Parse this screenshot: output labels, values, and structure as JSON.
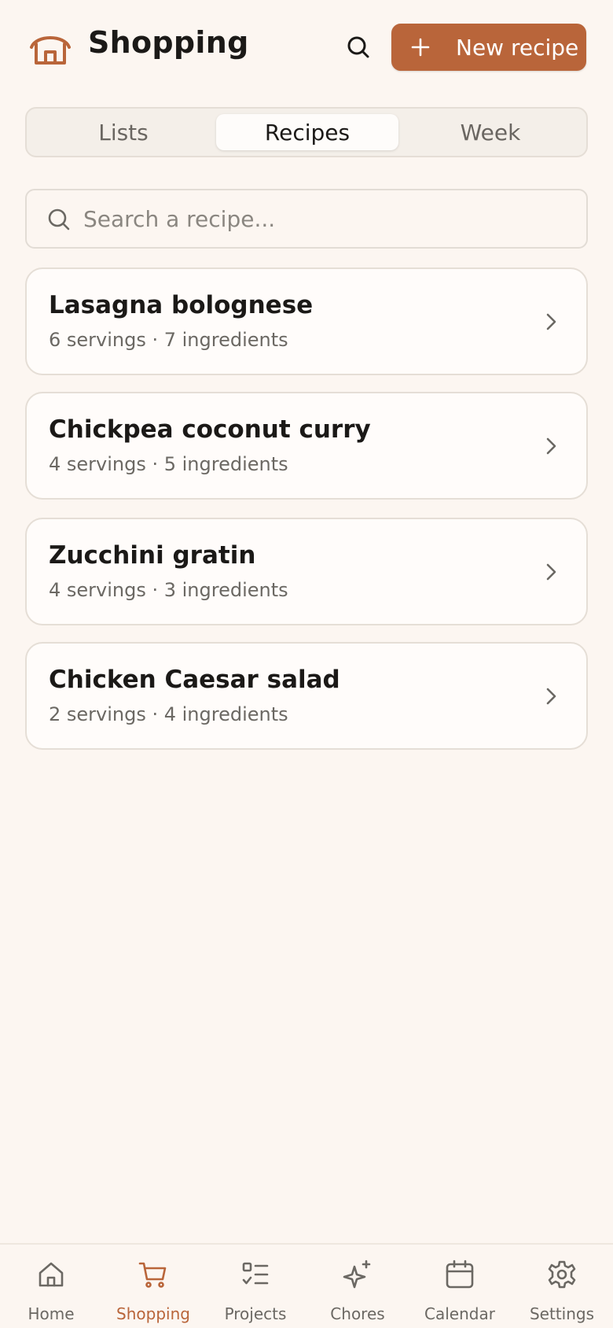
{
  "header": {
    "title": "Shopping",
    "new_button_label": "New recipe"
  },
  "tabs": [
    {
      "label": "Lists",
      "active": false
    },
    {
      "label": "Recipes",
      "active": true
    },
    {
      "label": "Week",
      "active": false
    }
  ],
  "search": {
    "placeholder": "Search a recipe...",
    "value": ""
  },
  "recipes": [
    {
      "name": "Lasagna bolognese",
      "meta": "6 servings · 7 ingredients"
    },
    {
      "name": "Chickpea coconut curry",
      "meta": "4 servings · 5 ingredients"
    },
    {
      "name": "Zucchini gratin",
      "meta": "4 servings · 3 ingredients"
    },
    {
      "name": "Chicken Caesar salad",
      "meta": "2 servings · 4 ingredients"
    }
  ],
  "bottom_nav": [
    {
      "label": "Home",
      "icon": "home-icon",
      "active": false
    },
    {
      "label": "Shopping",
      "icon": "cart-icon",
      "active": true
    },
    {
      "label": "Projects",
      "icon": "checklist-icon",
      "active": false
    },
    {
      "label": "Chores",
      "icon": "sparkle-icon",
      "active": false
    },
    {
      "label": "Calendar",
      "icon": "calendar-icon",
      "active": false
    },
    {
      "label": "Settings",
      "icon": "gear-icon",
      "active": false
    }
  ],
  "colors": {
    "accent": "#b9653a",
    "background": "#fcf6f1",
    "card": "#fffcfa",
    "muted_text": "#6b6863"
  }
}
